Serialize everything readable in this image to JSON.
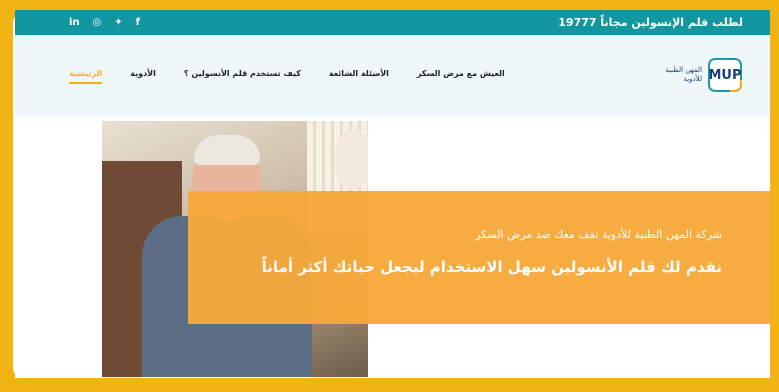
{
  "topbar": {
    "promo": "لطلب قلم الإنسولين مجاناً 19777",
    "socials": [
      {
        "icon": "linkedin-icon",
        "glyph": "in"
      },
      {
        "icon": "instagram-icon",
        "glyph": "◎"
      },
      {
        "icon": "twitter-icon",
        "glyph": "✦"
      },
      {
        "icon": "facebook-icon",
        "glyph": "f"
      }
    ]
  },
  "logo": {
    "mark": "MUP",
    "line1": "المهن الطبية",
    "line2": "للأدوية"
  },
  "nav": {
    "items": [
      {
        "label": "الرئيسية",
        "active": true
      },
      {
        "label": "الأدوية"
      },
      {
        "label": "كيف تستخدم قلم الأنسولين ؟"
      },
      {
        "label": "الأسئلة الشائعة"
      },
      {
        "label": "العيش مع مرض السكر"
      }
    ]
  },
  "hero": {
    "subtitle": "شركة المهن الطبية للأدوية تقف معك ضد مرض السكر",
    "headline": "نقدم لك قلم الأنسولين سهل الاستخدام ليجعل حياتك أكثر أماناً"
  },
  "colors": {
    "teal": "#1297a0",
    "yellow": "#f2b415",
    "orange": "#f6a93a"
  }
}
